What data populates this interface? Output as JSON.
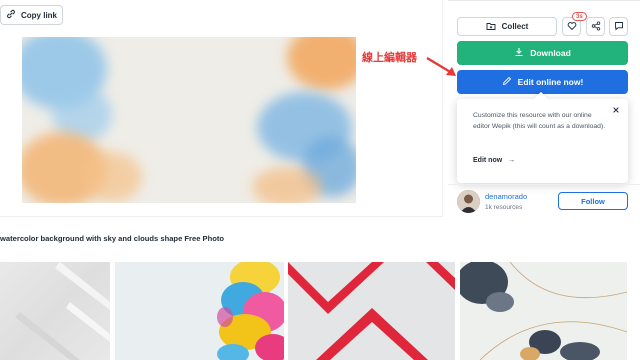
{
  "toolbar": {
    "copy_link": "Copy link",
    "collect": "Collect",
    "like_badge": "3s",
    "download": "Download",
    "edit_online": "Edit online now!"
  },
  "annotation": {
    "text": "線上編輯器",
    "color": "#e63a3a"
  },
  "popover": {
    "text": "Customize this resource with our online editor Wepik (this will count as a download).",
    "link": "Edit now",
    "link_arrow": "→"
  },
  "author": {
    "name": "denamorado",
    "resources": "1k resources",
    "follow": "Follow"
  },
  "resource_title": "watercolor background with sky and clouds shape Free Photo",
  "colors": {
    "download_green": "#22b27b",
    "edit_blue": "#1f6fe0",
    "badge_red": "#e25252"
  },
  "icons": [
    "link-icon",
    "folder-plus-icon",
    "heart-icon",
    "share-icon",
    "comment-icon",
    "download-icon",
    "pencil-icon",
    "close-icon",
    "arrow-right-icon"
  ]
}
